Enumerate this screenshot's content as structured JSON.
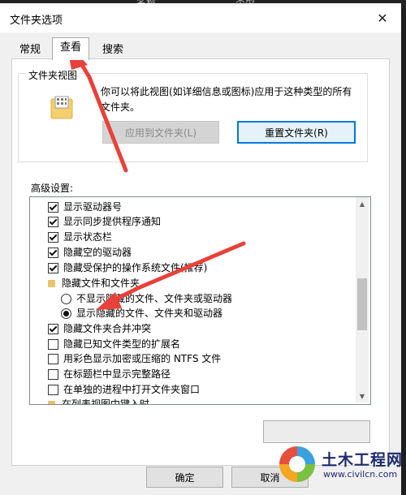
{
  "background": {
    "col1": "名称",
    "col2": "类型"
  },
  "window": {
    "title": "文件夹选项",
    "close_glyph": "✕"
  },
  "tabs": [
    {
      "label": "常规"
    },
    {
      "label": "查看"
    },
    {
      "label": "搜索"
    }
  ],
  "folder_views": {
    "group_title": "文件夹视图",
    "description": "你可以将此视图(如详细信息或图标)应用于这种类型的所有文件夹。",
    "apply_button": "应用到文件夹(L)",
    "reset_button": "重置文件夹(R)"
  },
  "advanced": {
    "label": "高级设置:",
    "items": [
      {
        "type": "checkbox",
        "checked": true,
        "label": "显示驱动器号"
      },
      {
        "type": "checkbox",
        "checked": true,
        "label": "显示同步提供程序通知"
      },
      {
        "type": "checkbox",
        "checked": true,
        "label": "显示状态栏"
      },
      {
        "type": "checkbox",
        "checked": true,
        "label": "隐藏空的驱动器"
      },
      {
        "type": "checkbox",
        "checked": true,
        "label": "隐藏受保护的操作系统文件(推荐)"
      },
      {
        "type": "folder",
        "label": "隐藏文件和文件夹"
      },
      {
        "type": "radio",
        "checked": false,
        "label": "不显示隐藏的文件、文件夹或驱动器"
      },
      {
        "type": "radio",
        "checked": true,
        "label": "显示隐藏的文件、文件夹和驱动器"
      },
      {
        "type": "checkbox",
        "checked": true,
        "label": "隐藏文件夹合并冲突"
      },
      {
        "type": "checkbox",
        "checked": false,
        "label": "隐藏已知文件类型的扩展名"
      },
      {
        "type": "checkbox",
        "checked": false,
        "label": "用彩色显示加密或压缩的 NTFS 文件"
      },
      {
        "type": "checkbox",
        "checked": false,
        "label": "在标题栏中显示完整路径"
      },
      {
        "type": "checkbox",
        "checked": false,
        "label": "在单独的进程中打开文件夹窗口"
      },
      {
        "type": "folder",
        "label": "在列表视图中键入时"
      }
    ],
    "restore_button": ""
  },
  "footer": {
    "ok": "确定",
    "cancel": "取消"
  },
  "watermark": {
    "name": "土木工程网",
    "url": "www.civilcn.com"
  },
  "colors": {
    "accent": "#0078d7",
    "annotation_arrow": "#e8413a"
  }
}
